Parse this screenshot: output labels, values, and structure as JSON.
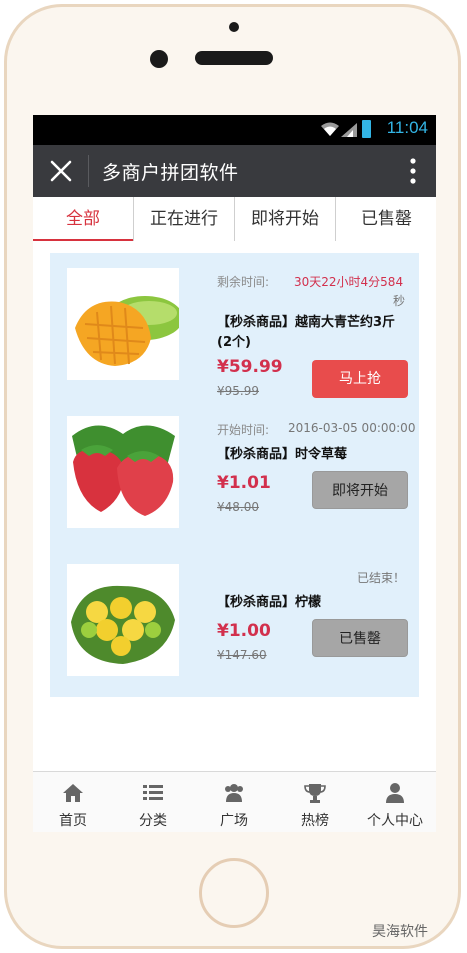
{
  "status_bar": {
    "time": "11:04"
  },
  "title_bar": {
    "title": "多商户拼团软件",
    "close_icon": "close-icon",
    "more_icon": "more-vertical-icon"
  },
  "tabs": [
    {
      "label": "全部",
      "active": true
    },
    {
      "label": "正在进行",
      "active": false
    },
    {
      "label": "即将开始",
      "active": false
    },
    {
      "label": "已售罄",
      "active": false
    }
  ],
  "products": [
    {
      "image": "mango",
      "info_label": "剩余时间:",
      "info_value": "30天22小时4分584",
      "info_value_cont": "秒",
      "name": "【秒杀商品】越南大青芒约3斤(2个)",
      "price": "¥59.99",
      "old_price": "¥95.99",
      "button": "马上抢"
    },
    {
      "image": "strawberry",
      "info_label": "开始时间:",
      "info_value": "2016-03-05 00:00:00",
      "name": "【秒杀商品】时令草莓",
      "price": "¥1.01",
      "old_price": "¥48.00",
      "button": "即将开始"
    },
    {
      "image": "lemon",
      "info_value": "已结束！",
      "name": "【秒杀商品】柠檬",
      "price": "¥1.00",
      "old_price": "¥147.60",
      "button": "已售罄"
    }
  ],
  "bottom_nav": [
    {
      "label": "首页",
      "icon": "home-icon"
    },
    {
      "label": "分类",
      "icon": "list-icon"
    },
    {
      "label": "广场",
      "icon": "users-icon"
    },
    {
      "label": "热榜",
      "icon": "trophy-icon"
    },
    {
      "label": "个人中心",
      "icon": "user-icon"
    }
  ],
  "watermark_right": "昊海软件",
  "colors": {
    "accent": "#d7323e",
    "title_bar": "#393a3e",
    "card_bg": "#e1f0fb",
    "price": "#d2304d",
    "status_text": "#33b5e5"
  }
}
